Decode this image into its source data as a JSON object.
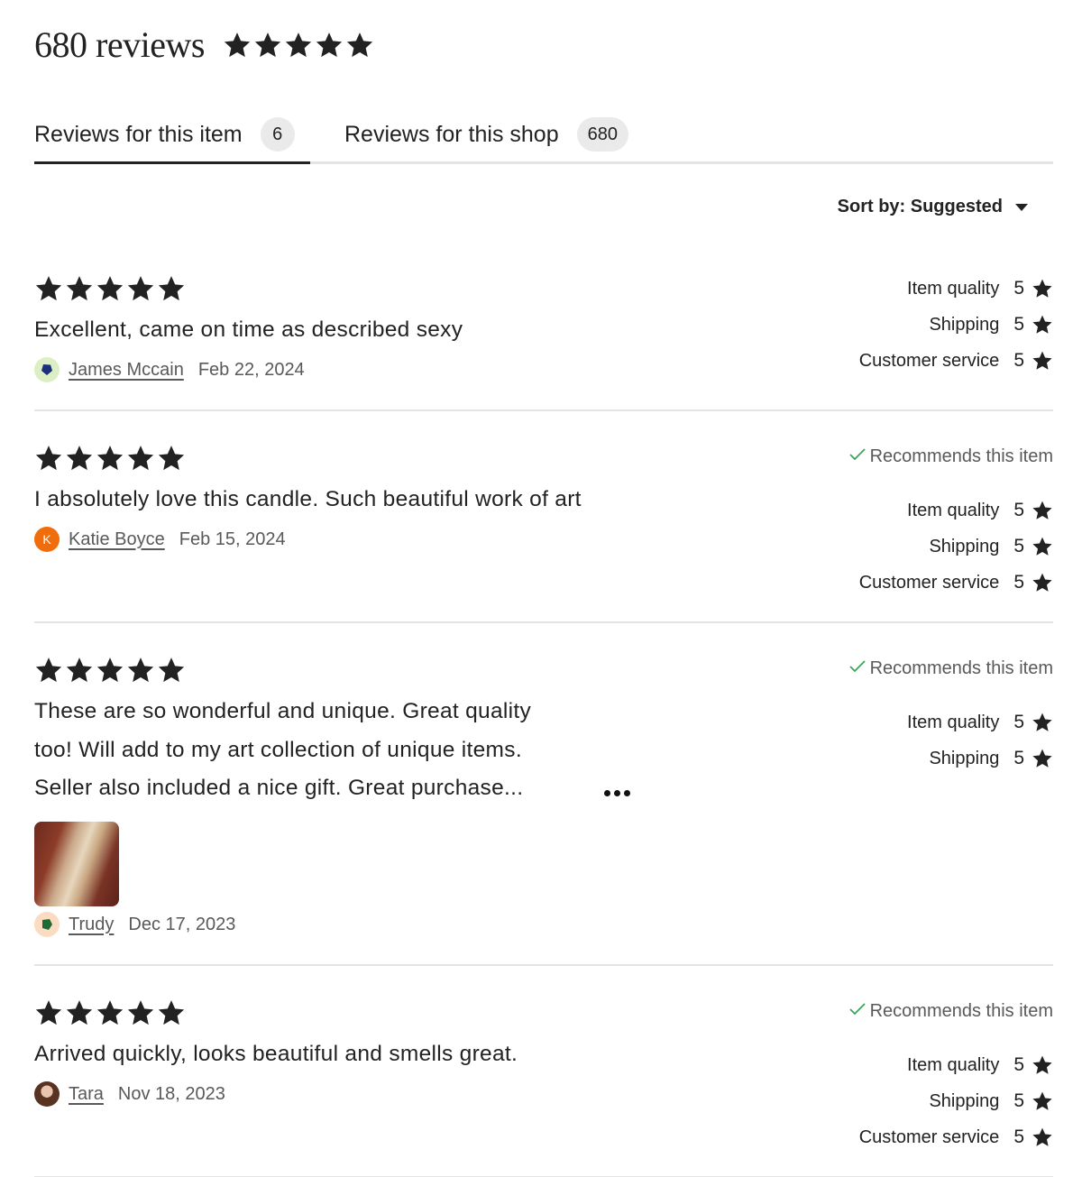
{
  "header": {
    "title": "680 reviews",
    "rating": 5
  },
  "tabs": [
    {
      "label": "Reviews for this item",
      "count": "6",
      "active": true
    },
    {
      "label": "Reviews for this shop",
      "count": "680",
      "active": false
    }
  ],
  "sort": {
    "label": "Sort by: Suggested"
  },
  "colors": {
    "star": "#222222",
    "check": "#3aa65b",
    "avatar_k": "#f16c0a"
  },
  "reviews": [
    {
      "rating": 5,
      "text": "Excellent, came on time as described sexy",
      "author": "James Mccain",
      "date": "Feb 22, 2024",
      "avatar_icon": "hexagon-avatar-icon",
      "recommends": "",
      "ratings": [
        {
          "label": "Item quality",
          "value": "5"
        },
        {
          "label": "Shipping",
          "value": "5"
        },
        {
          "label": "Customer service",
          "value": "5"
        }
      ]
    },
    {
      "rating": 5,
      "text": "I absolutely love this candle. Such beautiful work of art",
      "author": "Katie Boyce",
      "date": "Feb 15, 2024",
      "avatar_letter": "K",
      "recommends": "Recommends this item",
      "ratings": [
        {
          "label": "Item quality",
          "value": "5"
        },
        {
          "label": "Shipping",
          "value": "5"
        },
        {
          "label": "Customer service",
          "value": "5"
        }
      ]
    },
    {
      "rating": 5,
      "text_lines": [
        "These are so wonderful and unique. Great quality",
        "too! Will add to my art collection of unique items.",
        "Seller also included a nice gift. Great purchase..."
      ],
      "author": "Trudy",
      "date": "Dec 17, 2023",
      "avatar_icon": "hexagon-avatar-icon",
      "recommends": "Recommends this item",
      "ratings": [
        {
          "label": "Item quality",
          "value": "5"
        },
        {
          "label": "Shipping",
          "value": "5"
        }
      ]
    },
    {
      "rating": 5,
      "text": "Arrived quickly, looks beautiful and smells great.",
      "author": "Tara",
      "date": "Nov 18, 2023",
      "avatar_icon": "photo-avatar-icon",
      "recommends": "Recommends this item",
      "ratings": [
        {
          "label": "Item quality",
          "value": "5"
        },
        {
          "label": "Shipping",
          "value": "5"
        },
        {
          "label": "Customer service",
          "value": "5"
        }
      ]
    }
  ]
}
